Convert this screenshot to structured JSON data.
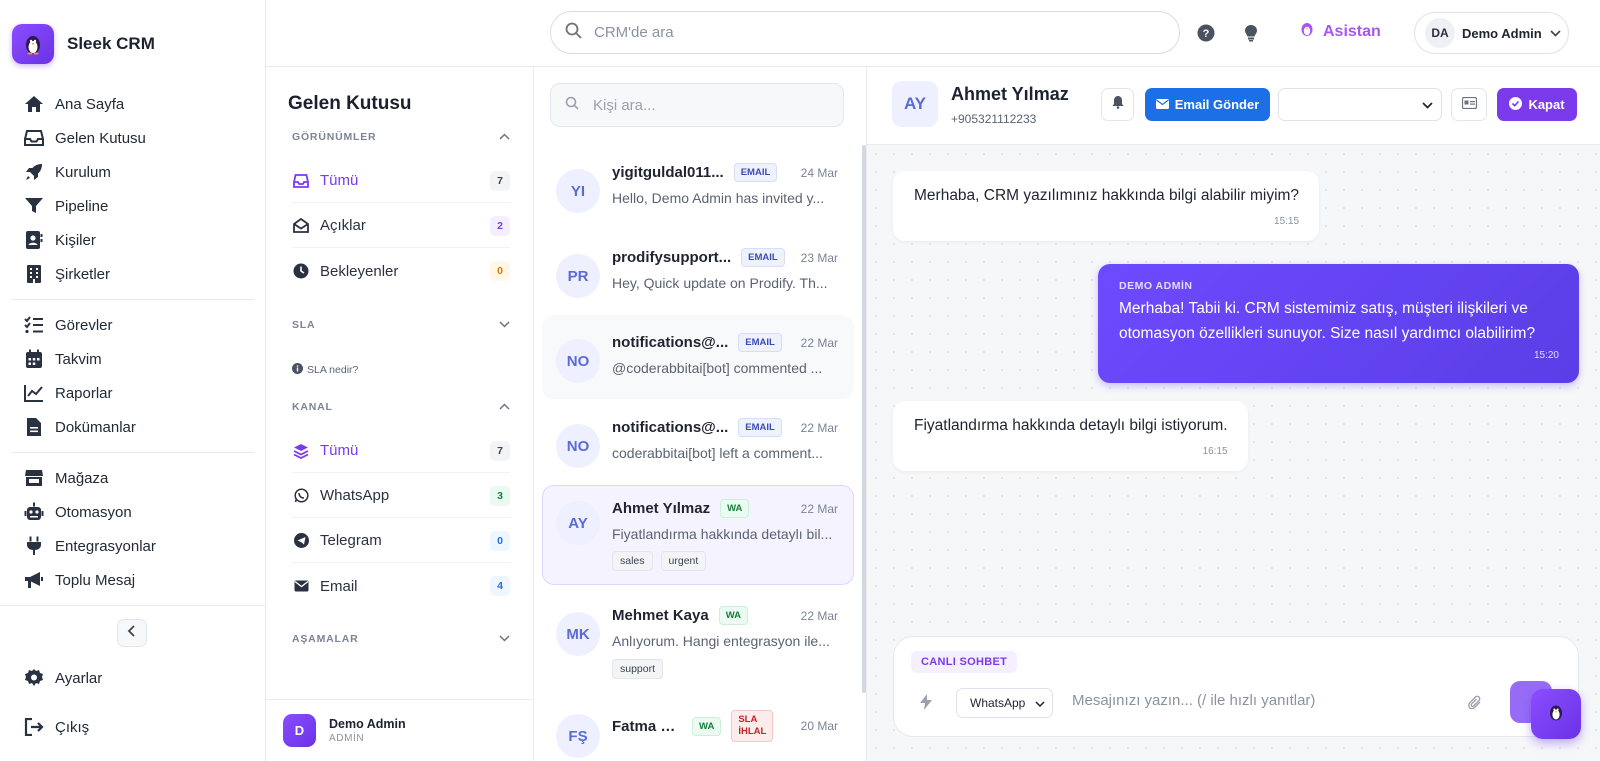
{
  "brand": {
    "name": "Sleek CRM"
  },
  "sidebar": {
    "group1": [
      {
        "label": "Ana Sayfa",
        "icon": "home-icon"
      },
      {
        "label": "Gelen Kutusu",
        "icon": "inbox-icon"
      },
      {
        "label": "Kurulum",
        "icon": "rocket-icon"
      },
      {
        "label": "Pipeline",
        "icon": "filter-icon"
      },
      {
        "label": "Kişiler",
        "icon": "contact-icon"
      },
      {
        "label": "Şirketler",
        "icon": "building-icon"
      }
    ],
    "group2": [
      {
        "label": "Görevler",
        "icon": "tasks-icon"
      },
      {
        "label": "Takvim",
        "icon": "calendar-icon"
      },
      {
        "label": "Raporlar",
        "icon": "chart-icon"
      },
      {
        "label": "Dokümanlar",
        "icon": "document-icon"
      }
    ],
    "group3": [
      {
        "label": "Mağaza",
        "icon": "store-icon"
      },
      {
        "label": "Otomasyon",
        "icon": "robot-icon"
      },
      {
        "label": "Entegrasyonlar",
        "icon": "plug-icon"
      },
      {
        "label": "Toplu Mesaj",
        "icon": "megaphone-icon"
      }
    ],
    "settings": "Ayarlar",
    "logout": "Çıkış"
  },
  "topbar": {
    "search_placeholder": "CRM'de ara",
    "assistant": "Asistan",
    "user_initials": "DA",
    "user_name": "Demo Admin"
  },
  "filters": {
    "title": "Gelen Kutusu",
    "views_header": "GÖRÜNÜMLER",
    "views": [
      {
        "label": "Tümü",
        "count": "7"
      },
      {
        "label": "Açıklar",
        "count": "2"
      },
      {
        "label": "Bekleyenler",
        "count": "0"
      }
    ],
    "sla_header": "SLA",
    "sla_hint": "SLA nedir?",
    "channel_header": "KANAL",
    "channels": [
      {
        "label": "Tümü",
        "count": "7"
      },
      {
        "label": "WhatsApp",
        "count": "3"
      },
      {
        "label": "Telegram",
        "count": "0"
      },
      {
        "label": "Email",
        "count": "4"
      }
    ],
    "stages_header": "AŞAMALAR",
    "user": {
      "initial": "D",
      "name": "Demo Admin",
      "role": "ADMİN"
    }
  },
  "contacts": {
    "search_placeholder": "Kişi ara...",
    "items": [
      {
        "initials": "YI",
        "name": "yigitguldal011...",
        "tag": "EMAIL",
        "date": "24 Mar",
        "snippet": "Hello, Demo Admin has invited y..."
      },
      {
        "initials": "PR",
        "name": "prodifysupport...",
        "tag": "EMAIL",
        "date": "23 Mar",
        "snippet": "Hey, Quick update on Prodify. Th..."
      },
      {
        "initials": "NO",
        "name": "notifications@...",
        "tag": "EMAIL",
        "date": "22 Mar",
        "snippet": "@coderabbitai[bot] commented ..."
      },
      {
        "initials": "NO",
        "name": "notifications@...",
        "tag": "EMAIL",
        "date": "22 Mar",
        "snippet": "coderabbitai[bot] left a comment..."
      },
      {
        "initials": "AY",
        "name": "Ahmet Yılmaz",
        "tag": "WA",
        "date": "22 Mar",
        "snippet": "Fiyatlandırma hakkında detaylı bil...",
        "labels": [
          "sales",
          "urgent"
        ]
      },
      {
        "initials": "MK",
        "name": "Mehmet Kaya",
        "tag": "WA",
        "date": "22 Mar",
        "snippet": "Anlıyorum. Hangi entegrasyon ile...",
        "labels": [
          "support"
        ]
      },
      {
        "initials": "FŞ",
        "name": "Fatma Ş...",
        "tag": "WA",
        "tag2_line1": "SLA",
        "tag2_line2": "İHLAL",
        "date": "20 Mar"
      }
    ]
  },
  "chat": {
    "initials": "AY",
    "name": "Ahmet Yılmaz",
    "phone": "+905321112233",
    "email_button": "Email Gönder",
    "close_button": "Kapat",
    "messages": [
      {
        "text": "Merhaba, CRM yazılımınız hakkında bilgi alabilir miyim?",
        "time": "15:15"
      },
      {
        "sender": "DEMO ADMİN",
        "text": "Merhaba! Tabii ki. CRM sistemimiz satış, müşteri ilişkileri ve otomasyon özellikleri sunuyor. Size nasıl yardımcı olabilirim?",
        "time": "15:20"
      },
      {
        "text": "Fiyatlandırma hakkında detaylı bilgi istiyorum.",
        "time": "16:15"
      }
    ],
    "composer": {
      "mode": "CANLI SOHBET",
      "channel": "WhatsApp",
      "placeholder": "Mesajınızı yazın... (/ ile hızlı yanıtlar)"
    }
  },
  "colors": {
    "accent": "#7c3aed",
    "primary_blue": "#1d6fe8",
    "wa_green": "#15803d",
    "sla_red": "#c02626"
  }
}
